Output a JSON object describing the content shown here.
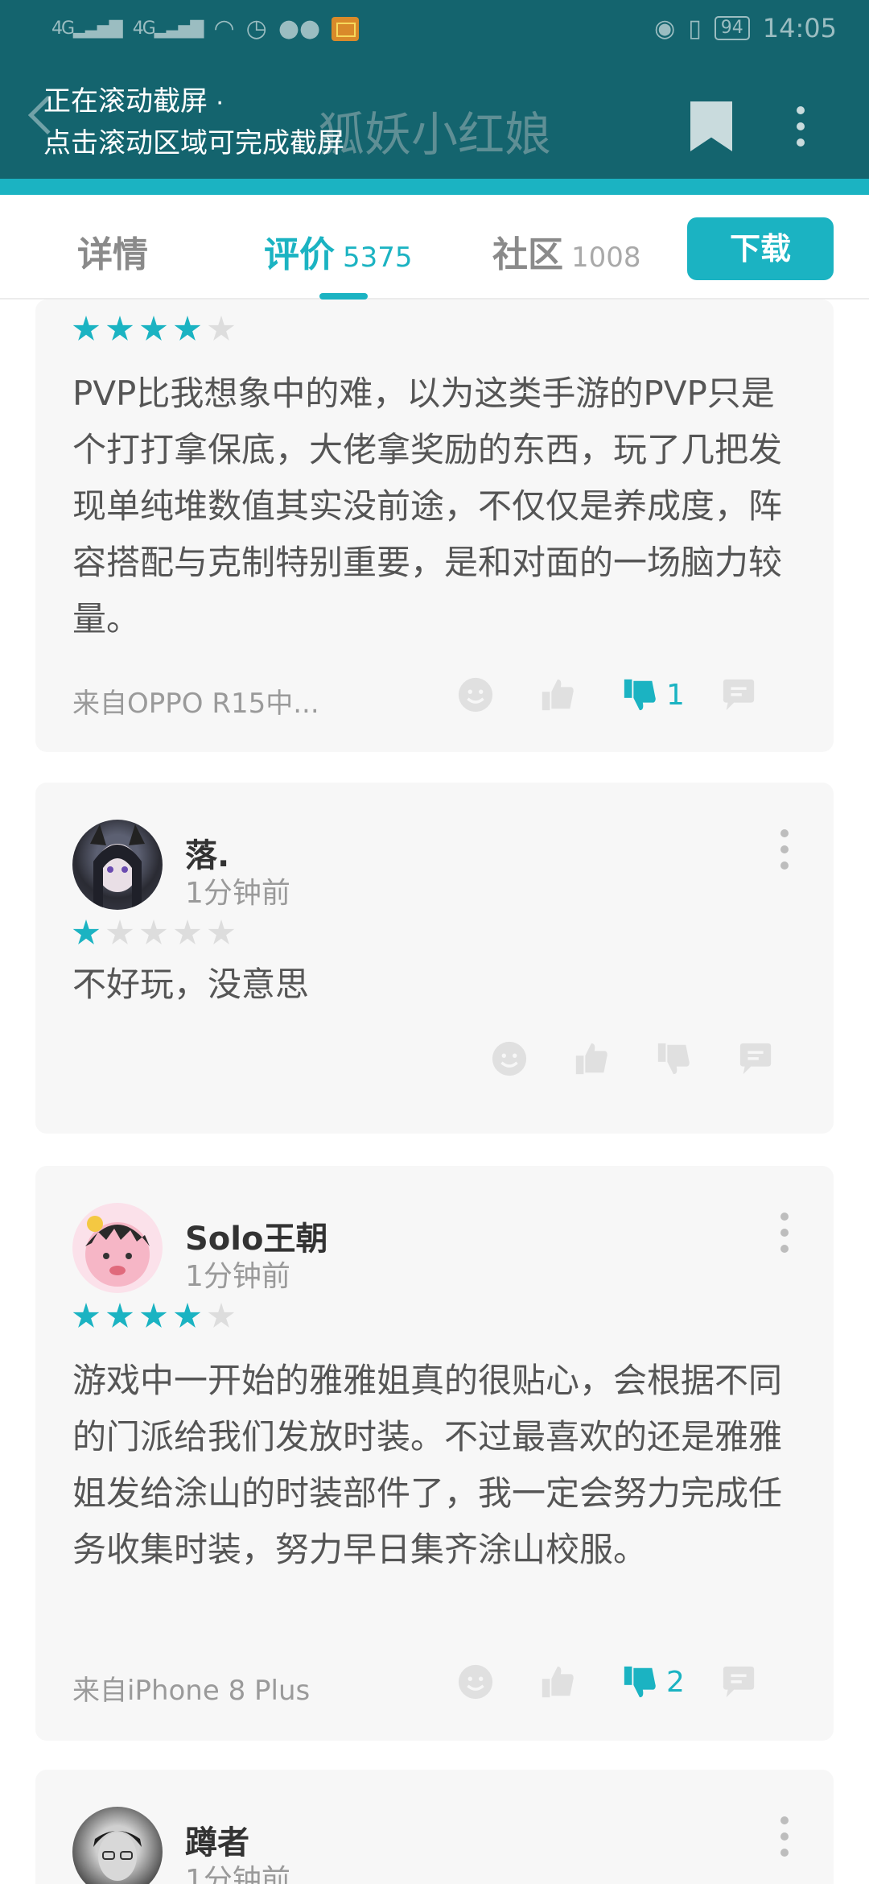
{
  "status_bar": {
    "signal1": "4G",
    "signal2": "4G",
    "battery": "94",
    "time": "14:05"
  },
  "header": {
    "title": "狐妖小红娘",
    "scroll_hint_line1": "正在滚动截屏 ·",
    "scroll_hint_line2": "点击滚动区域可完成截屏"
  },
  "tabs": [
    {
      "label": "详情",
      "count": ""
    },
    {
      "label": "评价",
      "count": "5375"
    },
    {
      "label": "社区",
      "count": "1008"
    }
  ],
  "download_label": "下载",
  "colors": {
    "accent": "#1bb3c2",
    "header_bg": "#14646e"
  },
  "reviews": [
    {
      "stars": 4,
      "text": "PVP比我想象中的难，以为这类手游的PVP只是个打打拿保底，大佬拿奖励的东西，玩了几把发现单纯堆数值其实没前途，不仅仅是养成度，阵容搭配与克制特别重要，是和对面的一场脑力较量。",
      "source": "来自OPPO R15中...",
      "dislike_count": "1"
    },
    {
      "username": "落.",
      "time": "1分钟前",
      "stars": 1,
      "text": "不好玩，没意思"
    },
    {
      "username": "Solo王朝",
      "time": "1分钟前",
      "stars": 4,
      "text": "游戏中一开始的雅雅姐真的很贴心，会根据不同的门派给我们发放时装。不过最喜欢的还是雅雅姐发给涂山的时装部件了，我一定会努力完成任务收集时装，努力早日集齐涂山校服。",
      "source": "来自iPhone 8 Plus",
      "dislike_count": "2"
    },
    {
      "username": "蹲者",
      "time": "1分钟前"
    }
  ]
}
